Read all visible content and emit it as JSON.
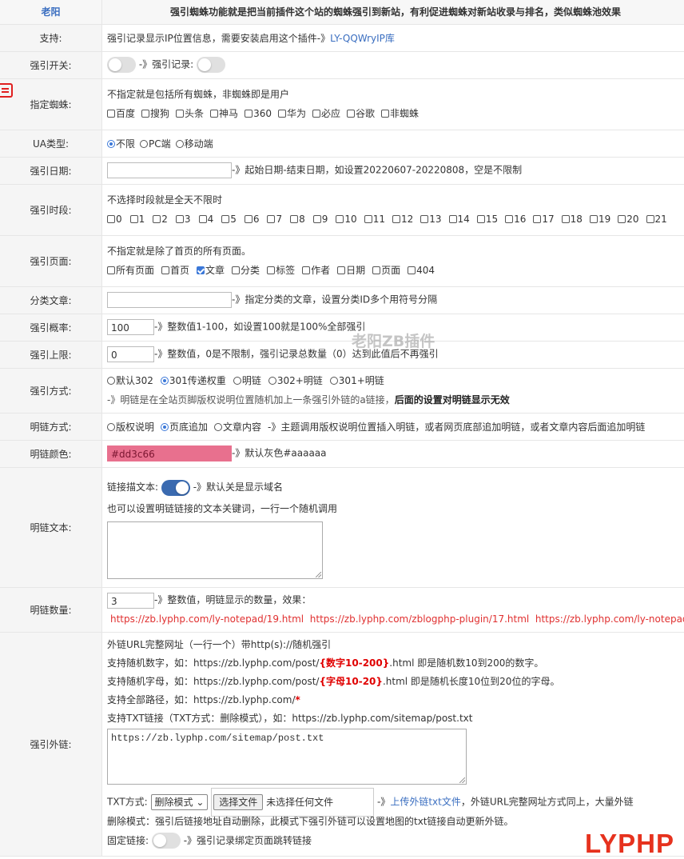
{
  "header": {
    "label": "老阳",
    "text": "强引蜘蛛功能就是把当前插件这个站的蜘蛛强引到新站，有利促进蜘蛛对新站收录与排名，类似蜘蛛池效果"
  },
  "support": {
    "label": "支持:",
    "text": "强引记录显示IP位置信息，需要安装启用这个插件-》",
    "link": "LY-QQWryIP库"
  },
  "switch_row": {
    "label": "强引开关:",
    "mid_text": "-》强引记录:"
  },
  "spider": {
    "label": "指定蜘蛛:",
    "hint": "不指定就是包括所有蜘蛛，非蜘蛛即是用户",
    "options": [
      "百度",
      "搜狗",
      "头条",
      "神马",
      "360",
      "华为",
      "必应",
      "谷歌",
      "非蜘蛛"
    ]
  },
  "ua": {
    "label": "UA类型:",
    "options": [
      "不限",
      "PC端",
      "移动端"
    ],
    "selected": "不限"
  },
  "date": {
    "label": "强引日期:",
    "value": "",
    "hint": "-》起始日期-结束日期，如设置20220607-20220808，空是不限制"
  },
  "period": {
    "label": "强引时段:",
    "hint": "不选择时段就是全天不限时",
    "hours": [
      "0",
      "1",
      "2",
      "3",
      "4",
      "5",
      "6",
      "7",
      "8",
      "9",
      "10",
      "11",
      "12",
      "13",
      "14",
      "15",
      "16",
      "17",
      "18",
      "19",
      "20",
      "21"
    ]
  },
  "pages": {
    "label": "强引页面:",
    "hint": "不指定就是除了首页的所有页面。",
    "options": [
      {
        "text": "所有页面",
        "checked": false
      },
      {
        "text": "首页",
        "checked": false
      },
      {
        "text": "文章",
        "checked": true
      },
      {
        "text": "分类",
        "checked": false
      },
      {
        "text": "标签",
        "checked": false
      },
      {
        "text": "作者",
        "checked": false
      },
      {
        "text": "日期",
        "checked": false
      },
      {
        "text": "页面",
        "checked": false
      },
      {
        "text": "404",
        "checked": false
      }
    ]
  },
  "category": {
    "label": "分类文章:",
    "value": "",
    "hint": "-》指定分类的文章，设置分类ID多个用符号分隔"
  },
  "probability": {
    "label": "强引概率:",
    "value": "100",
    "hint": "-》整数值1-100，如设置100就是100%全部强引"
  },
  "limit": {
    "label": "强引上限:",
    "value": "0",
    "hint": "-》整数值，0是不限制，强引记录总数量（0）达到此值后不再强引"
  },
  "method": {
    "label": "强引方式:",
    "options": [
      "默认302",
      "301传递权重",
      "明链",
      "302+明链",
      "301+明链"
    ],
    "selected": "301传递权重",
    "note": "-》明链是在全站页脚版权说明位置随机加上一条强引外链的a链接，",
    "note_bold": "后面的设置对明链显示无效"
  },
  "link_mode": {
    "label": "明链方式:",
    "options": [
      "版权说明",
      "页底追加",
      "文章内容"
    ],
    "selected": "页底追加",
    "hint": "-》主题调用版权说明位置插入明链，或者网页底部追加明链，或者文章内容后面追加明链"
  },
  "link_color": {
    "label": "明链颜色:",
    "value": "#dd3c66",
    "swatch": "#e8708e",
    "hint": "-》默认灰色#aaaaaa"
  },
  "link_text": {
    "label": "明链文本:",
    "anchor_label": "链接描文本:",
    "anchor_hint": "-》默认关是显示域名",
    "hint": "也可以设置明链链接的文本关键词，一行一个随机调用",
    "value": ""
  },
  "link_count": {
    "label": "明链数量:",
    "value": "3",
    "hint": "-》整数值，明链显示的数量，效果：",
    "examples": "https://zb.lyphp.com/ly-notepad/19.html  https://zb.lyphp.com/zblogphp-plugin/17.html  https://zb.lyphp.com/ly-notepad"
  },
  "external": {
    "label": "强引外链:",
    "l1": "外链URL完整网址（一行一个）带http(s)://随机强引",
    "l2a": "支持随机数字，如：https://zb.lyphp.com/post/",
    "l2b": "{数字10-200}",
    "l2c": ".html 即是随机数10到200的数字。",
    "l3a": "支持随机字母，如：https://zb.lyphp.com/post/",
    "l3b": "{字母10-20}",
    "l3c": ".html 即是随机长度10位到20位的字母。",
    "l4a": "支持全部路径，如：https://zb.lyphp.com/",
    "l4b": "*",
    "l5": "支持TXT链接（TXT方式：删除模式），如：https://zb.lyphp.com/sitemap/post.txt",
    "textarea": "https://zb.lyphp.com/sitemap/post.txt",
    "txt_label": "TXT方式:",
    "txt_mode": "删除模式",
    "file_button": "选择文件",
    "file_status": "未选择任何文件",
    "upload_prefix": "-》",
    "upload_link": "上传外链txt文件",
    "upload_suffix": "，外链URL完整网址方式同上，大量外链",
    "delete_note": "删除模式：强引后链接地址自动删除，此模式下强引外链可以设置地图的txt链接自动更新外链。",
    "fixed_label": "固定链接:",
    "fixed_hint": "-》强引记录绑定页面跳转链接"
  },
  "watermark": "老阳ZB插件",
  "logo": "LYPHP"
}
